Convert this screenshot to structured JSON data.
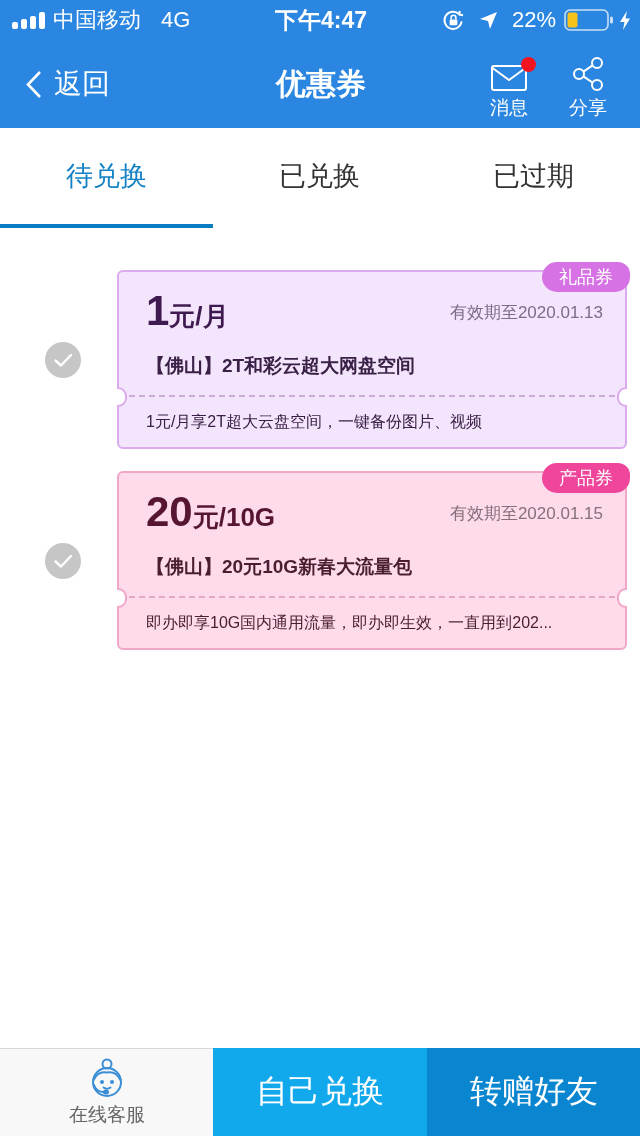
{
  "status_bar": {
    "carrier": "中国移动",
    "network": "4G",
    "time": "下午4:47",
    "battery": "22%"
  },
  "header": {
    "back": "返回",
    "title": "优惠券",
    "actions": [
      {
        "kind": "messages",
        "label": "消息",
        "unread": true
      },
      {
        "kind": "share",
        "label": "分享"
      }
    ]
  },
  "tabs": [
    {
      "label": "待兑换",
      "selected": true
    },
    {
      "label": "已兑换",
      "selected": false
    },
    {
      "label": "已过期",
      "selected": false
    }
  ],
  "coupons": [
    {
      "kind": "gift",
      "selected": false,
      "tag": "礼品券",
      "price": "1",
      "unit": "元/月",
      "expiry": "有效期至2020.01.13",
      "title": "【佛山】2T和彩云超大网盘空间",
      "description": "1元/月享2T超大云盘空间，一键备份图片、视频"
    },
    {
      "kind": "product",
      "selected": false,
      "tag": "产品券",
      "price": "20",
      "unit": "元/10G",
      "expiry": "有效期至2020.01.15",
      "title": "【佛山】20元10G新春大流量包",
      "description": "即办即享10G国内通用流量，即办即生效，一直用到202..."
    }
  ],
  "bottom_bar": {
    "service": "在线客服",
    "buttons": [
      {
        "kind": "primary",
        "label": "自己兑换"
      },
      {
        "kind": "secondary",
        "label": "转赠好友"
      }
    ]
  }
}
